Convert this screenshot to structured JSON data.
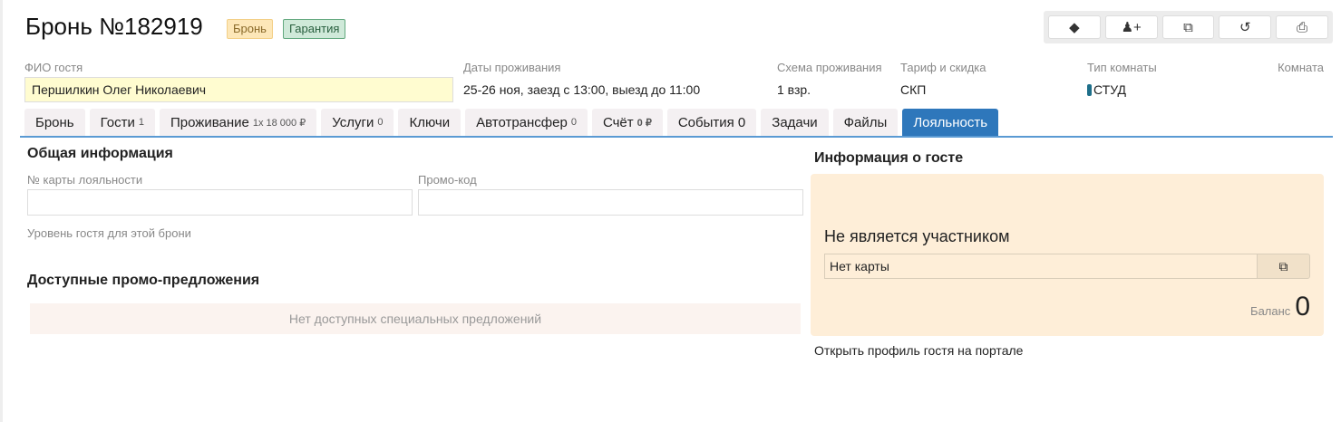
{
  "header": {
    "title": "Бронь №182919",
    "badges": [
      "Бронь",
      "Гарантия"
    ]
  },
  "toolbar": {
    "icons": [
      "tags-icon",
      "add-user-icon",
      "copy-icon",
      "undo-icon",
      "print-icon"
    ]
  },
  "fields": {
    "guest_label": "ФИО гостя",
    "guest_value": "Першилкин Олег Николаевич",
    "dates_label": "Даты проживания",
    "dates_value": "25-26 ноя, заезд с 13:00, выезд до 11:00",
    "scheme_label": "Схема проживания",
    "scheme_value": "1 взр.",
    "rate_label": "Тариф и скидка",
    "rate_value": "СКП",
    "roomtype_label": "Тип комнаты",
    "roomtype_value": "СТУД",
    "roomtype_color": "#1e6f8a",
    "room_label": "Комната"
  },
  "tabs": [
    {
      "label": "Бронь",
      "count": ""
    },
    {
      "label": "Гости",
      "count": "1"
    },
    {
      "label": "Проживание",
      "count": "1x 18 000 ₽"
    },
    {
      "label": "Услуги",
      "count": "0"
    },
    {
      "label": "Ключи",
      "count": ""
    },
    {
      "label": "Автотрансфер",
      "count": "0"
    },
    {
      "label": "Счёт",
      "count": "0 ₽"
    },
    {
      "label": "События 0",
      "count": ""
    },
    {
      "label": "Задачи",
      "count": ""
    },
    {
      "label": "Файлы",
      "count": ""
    },
    {
      "label": "Лояльность",
      "count": ""
    }
  ],
  "loyalty": {
    "general_title": "Общая информация",
    "card_label": "№ карты лояльности",
    "card_value": "",
    "promo_label": "Промо-код",
    "promo_value": "",
    "level_label": "Уровень гостя для этой брони",
    "offers_title": "Доступные промо-предложения",
    "no_offers": "Нет доступных специальных предложений",
    "guest_title": "Информация о госте",
    "status": "Не является участником",
    "card_field": "Нет карты",
    "balance_label": "Баланс",
    "balance_value": "0",
    "portal_link": "Открыть профиль гостя на портале"
  }
}
